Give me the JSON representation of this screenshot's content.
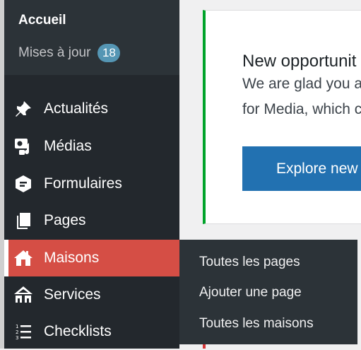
{
  "top_submenu": {
    "home_label": "Accueil",
    "updates_label": "Mises à jour",
    "updates_count": "18"
  },
  "menu": [
    {
      "label": "Actualités",
      "icon": "pin-icon"
    },
    {
      "label": "Médias",
      "icon": "media-icon"
    },
    {
      "label": "Formulaires",
      "icon": "forms-icon"
    },
    {
      "label": "Pages",
      "icon": "pages-icon"
    },
    {
      "label": "Maisons",
      "icon": "house-icon",
      "active": true
    },
    {
      "label": "Services",
      "icon": "services-icon"
    },
    {
      "label": "Checklists",
      "icon": "checklist-icon"
    }
  ],
  "flyout": [
    "Toutes les pages",
    "Ajouter une page",
    "Toutes les maisons"
  ],
  "notice": {
    "title": "New opportunit",
    "line1": "We are glad you a",
    "line2": "for Media, which c",
    "button": "Explore new f"
  },
  "colors": {
    "sidebar_bg": "#23282d",
    "active_bg": "#d54e45",
    "badge_bg": "#5596b4",
    "notice_border": "#00a32a",
    "button_bg": "#2271b1"
  }
}
